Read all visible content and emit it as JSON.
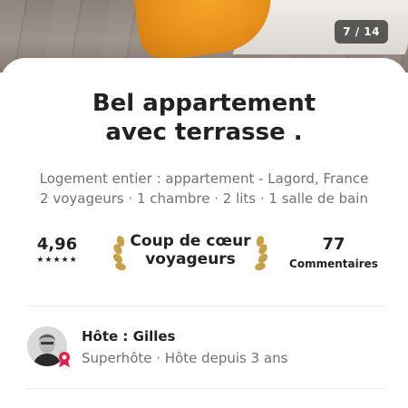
{
  "photo": {
    "counter": "7 / 14"
  },
  "listing": {
    "title_line1": "Bel appartement",
    "title_line2": "avec terrasse .",
    "subtitle_line1": "Logement entier : appartement - Lagord, France",
    "subtitle_line2": "2 voyageurs · 1 chambre · 2 lits · 1 salle de bain"
  },
  "stats": {
    "rating": "4,96",
    "stars": "★★★★★",
    "stars_count": 5,
    "favorite_line1": "Coup de cœur",
    "favorite_line2": "voyageurs",
    "reviews_count": "77",
    "reviews_label": "Commentaires"
  },
  "host": {
    "name": "Hôte : Gilles",
    "meta": "Superhôte · Hôte depuis 3 ans"
  },
  "colors": {
    "text_primary": "#222222",
    "text_secondary": "#717171",
    "accent_superhost": "#e61e4d",
    "laurel_gold": "#c8a046"
  }
}
